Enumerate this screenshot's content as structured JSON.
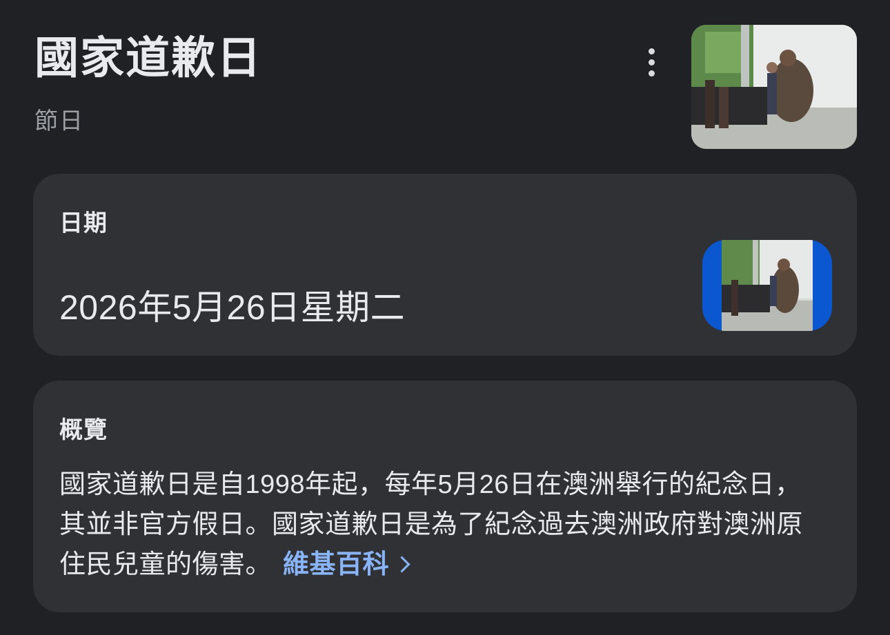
{
  "header": {
    "title": "國家道歉日",
    "subtitle": "節日"
  },
  "icons": {
    "more": "more-vert-icon",
    "link_arrow": "chevron-right-icon"
  },
  "date_card": {
    "heading": "日期",
    "value": "2026年5月26日星期二"
  },
  "overview_card": {
    "heading": "概覽",
    "text": "國家道歉日是自1998年起，每年5月26日在澳洲舉行的紀念日，其並非官方假日。國家道歉日是為了紀念過去澳洲政府對澳洲原住民兒童的傷害。",
    "source_link": "維基百科"
  },
  "colors": {
    "background": "#202124",
    "card": "#303134",
    "text_primary": "#e8eaed",
    "text_secondary": "#9aa0a6",
    "link": "#8ab4f8",
    "thumb_frame": "#0b57d0"
  }
}
